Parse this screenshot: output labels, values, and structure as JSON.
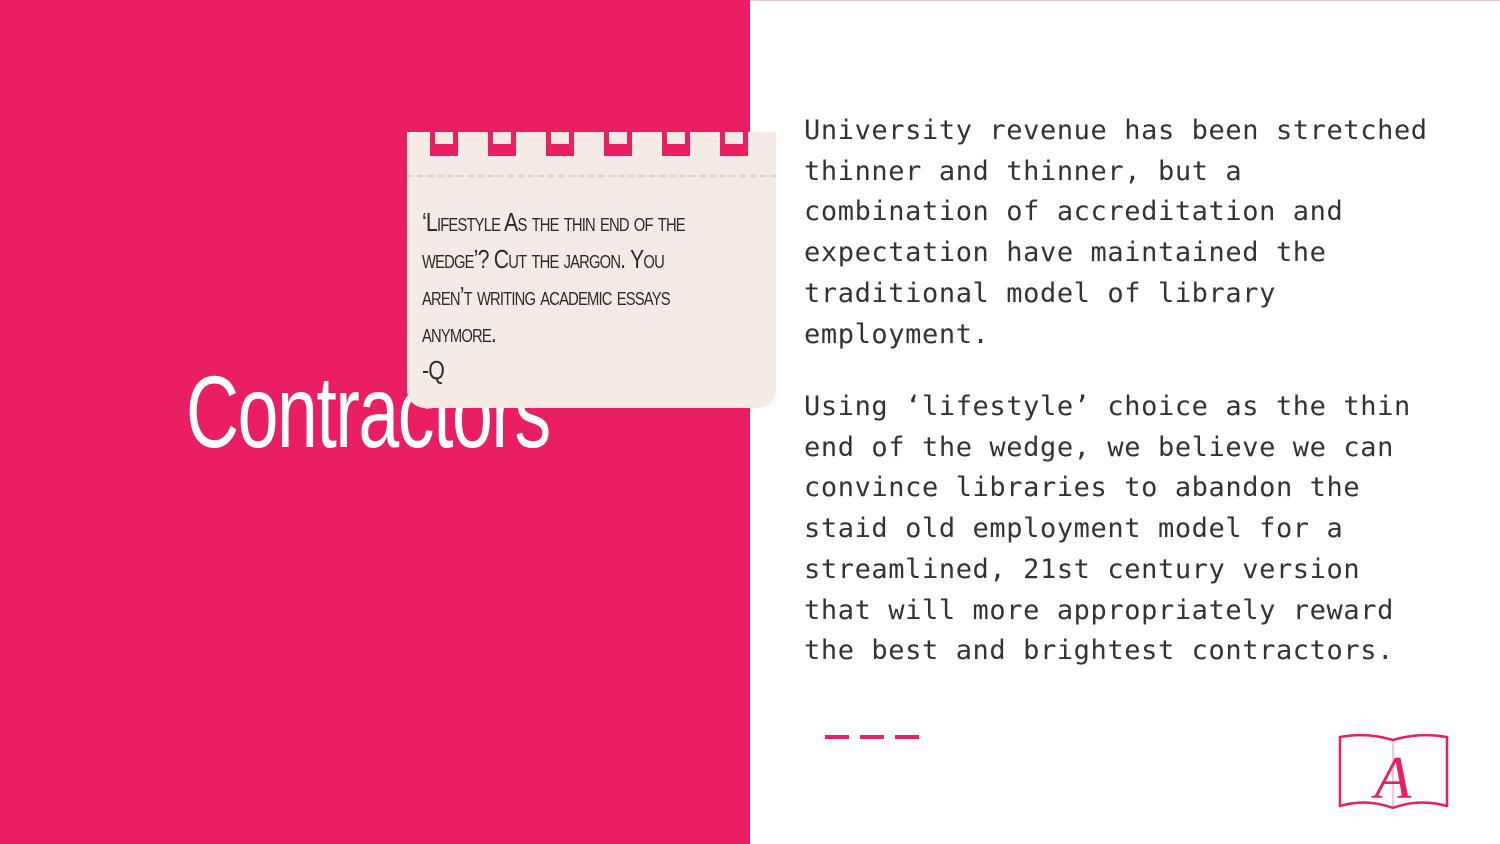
{
  "slide": {
    "title": "Contractors",
    "note": {
      "text": "‘Lifestyle As the thin end of the wedge’? Cut the jargon. You aren’t writing academic essays anymore.\n-Q"
    },
    "paragraphs": [
      "University revenue has been stretched thinner and thinner, but a combination of accreditation and expectation have maintained the traditional model of library employment.",
      "Using ‘lifestyle’ choice as the thin end of the wedge, we believe we can convince libraries to abandon the staid old employment model for a streamlined, 21st century version that will more appropriately reward the best and brightest contractors."
    ],
    "logo": {
      "letter": "A",
      "icon": "open-book-icon"
    }
  },
  "colors": {
    "accent": "#e91e63",
    "note_background": "#f6ebe4",
    "body_text": "#333333"
  }
}
